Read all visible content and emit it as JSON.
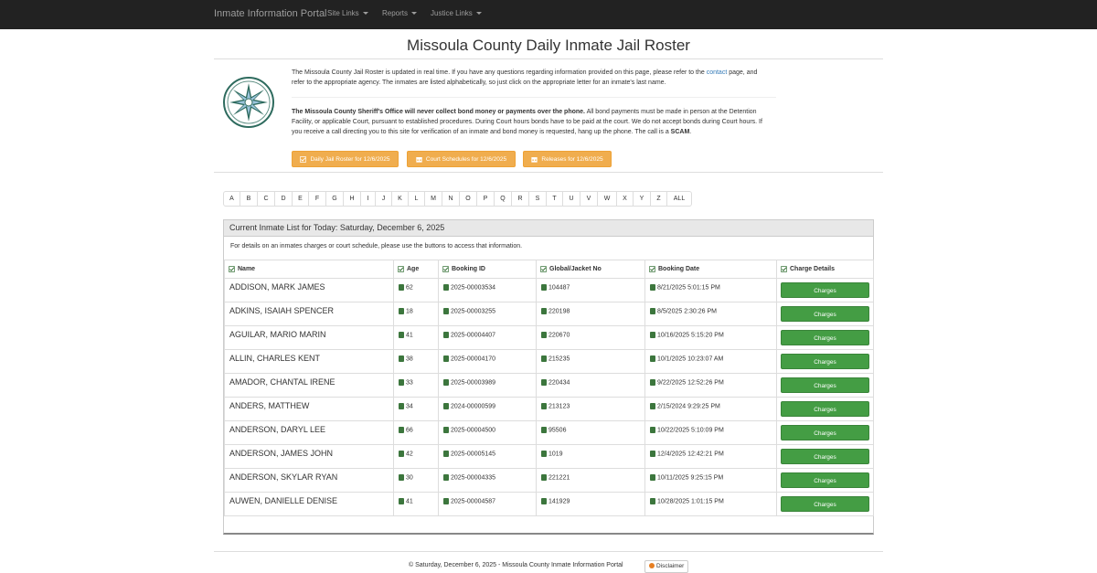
{
  "navbar": {
    "brand": "Inmate Information Portal",
    "links": [
      "Site Links",
      "Reports",
      "Justice Links"
    ]
  },
  "page": {
    "title": "Missoula County Daily Inmate Jail Roster",
    "intro_pre": "The Missoula County Jail Roster is updated in real time. If you have any questions regarding information provided on this page, please refer to the ",
    "intro_link": "contact",
    "intro_post": " page, and refer to the appropriate agency. The inmates are listed alphabetically, so just click on the appropriate letter for an inmate's last name.",
    "warn_bold": "The Missoula County Sheriff's Office will never collect bond money or payments over the phone.",
    "warn_text": " All bond payments must be made in person at the Detention Facility, or applicable Court, pursuant to established procedures. During Court hours bonds have to be paid at the court. We do not accept bonds during Court hours. If you receive a call directing you to this site for verification of an inmate and bond money is requested, hang up the phone. The call is a ",
    "warn_scam": "SCAM",
    "warn_end": ".",
    "buttons": [
      "Daily Jail Roster for 12/6/2025",
      "Court Schedules for 12/6/2025",
      "Releases for 12/6/2025"
    ]
  },
  "alphabet": [
    "A",
    "B",
    "C",
    "D",
    "E",
    "F",
    "G",
    "H",
    "I",
    "J",
    "K",
    "L",
    "M",
    "N",
    "O",
    "P",
    "Q",
    "R",
    "S",
    "T",
    "U",
    "V",
    "W",
    "X",
    "Y",
    "Z",
    "ALL"
  ],
  "panel": {
    "title": "Current Inmate List for Today: Saturday, December 6, 2025",
    "note": "For details on an inmates charges or court schedule, please use the buttons to access that information.",
    "columns": [
      "Name",
      "Age",
      "Booking ID",
      "Global/Jacket No",
      "Booking Date",
      "Charge Details"
    ],
    "charges_label": "Charges",
    "rows": [
      {
        "name": "ADDISON, MARK JAMES",
        "age": "62",
        "booking_id": "2025-00003534",
        "jacket": "104487",
        "date": "8/21/2025 5:01:15 PM"
      },
      {
        "name": "ADKINS, ISAIAH SPENCER",
        "age": "18",
        "booking_id": "2025-00003255",
        "jacket": "220198",
        "date": "8/5/2025 2:30:26 PM"
      },
      {
        "name": "AGUILAR, MARIO MARIN",
        "age": "41",
        "booking_id": "2025-00004407",
        "jacket": "220670",
        "date": "10/16/2025 5:15:20 PM"
      },
      {
        "name": "ALLIN, CHARLES KENT",
        "age": "38",
        "booking_id": "2025-00004170",
        "jacket": "215235",
        "date": "10/1/2025 10:23:07 AM"
      },
      {
        "name": "AMADOR, CHANTAL IRENE",
        "age": "33",
        "booking_id": "2025-00003989",
        "jacket": "220434",
        "date": "9/22/2025 12:52:26 PM"
      },
      {
        "name": "ANDERS, MATTHEW",
        "age": "34",
        "booking_id": "2024-00000599",
        "jacket": "213123",
        "date": "2/15/2024 9:29:25 PM"
      },
      {
        "name": "ANDERSON, DARYL LEE",
        "age": "66",
        "booking_id": "2025-00004500",
        "jacket": "95506",
        "date": "10/22/2025 5:10:09 PM"
      },
      {
        "name": "ANDERSON, JAMES JOHN",
        "age": "42",
        "booking_id": "2025-00005145",
        "jacket": "1019",
        "date": "12/4/2025 12:42:21 PM"
      },
      {
        "name": "ANDERSON, SKYLAR RYAN",
        "age": "30",
        "booking_id": "2025-00004335",
        "jacket": "221221",
        "date": "10/11/2025 9:25:15 PM"
      },
      {
        "name": "AUWEN, DANIELLE DENISE",
        "age": "41",
        "booking_id": "2025-00004587",
        "jacket": "141929",
        "date": "10/28/2025 1:01:15 PM"
      }
    ]
  },
  "footer": {
    "text": "© Saturday, December 6, 2025 - Missoula County Inmate Information Portal",
    "disclaimer": "Disclaimer"
  },
  "colors": {
    "navbar": "#222222",
    "orange_button": "#f0ad4e",
    "green_button": "#449d44",
    "icon_green": "#3c763d"
  },
  "icons": [
    "county-seal-icon",
    "check-square-icon",
    "calendar-icon",
    "book-icon"
  ]
}
